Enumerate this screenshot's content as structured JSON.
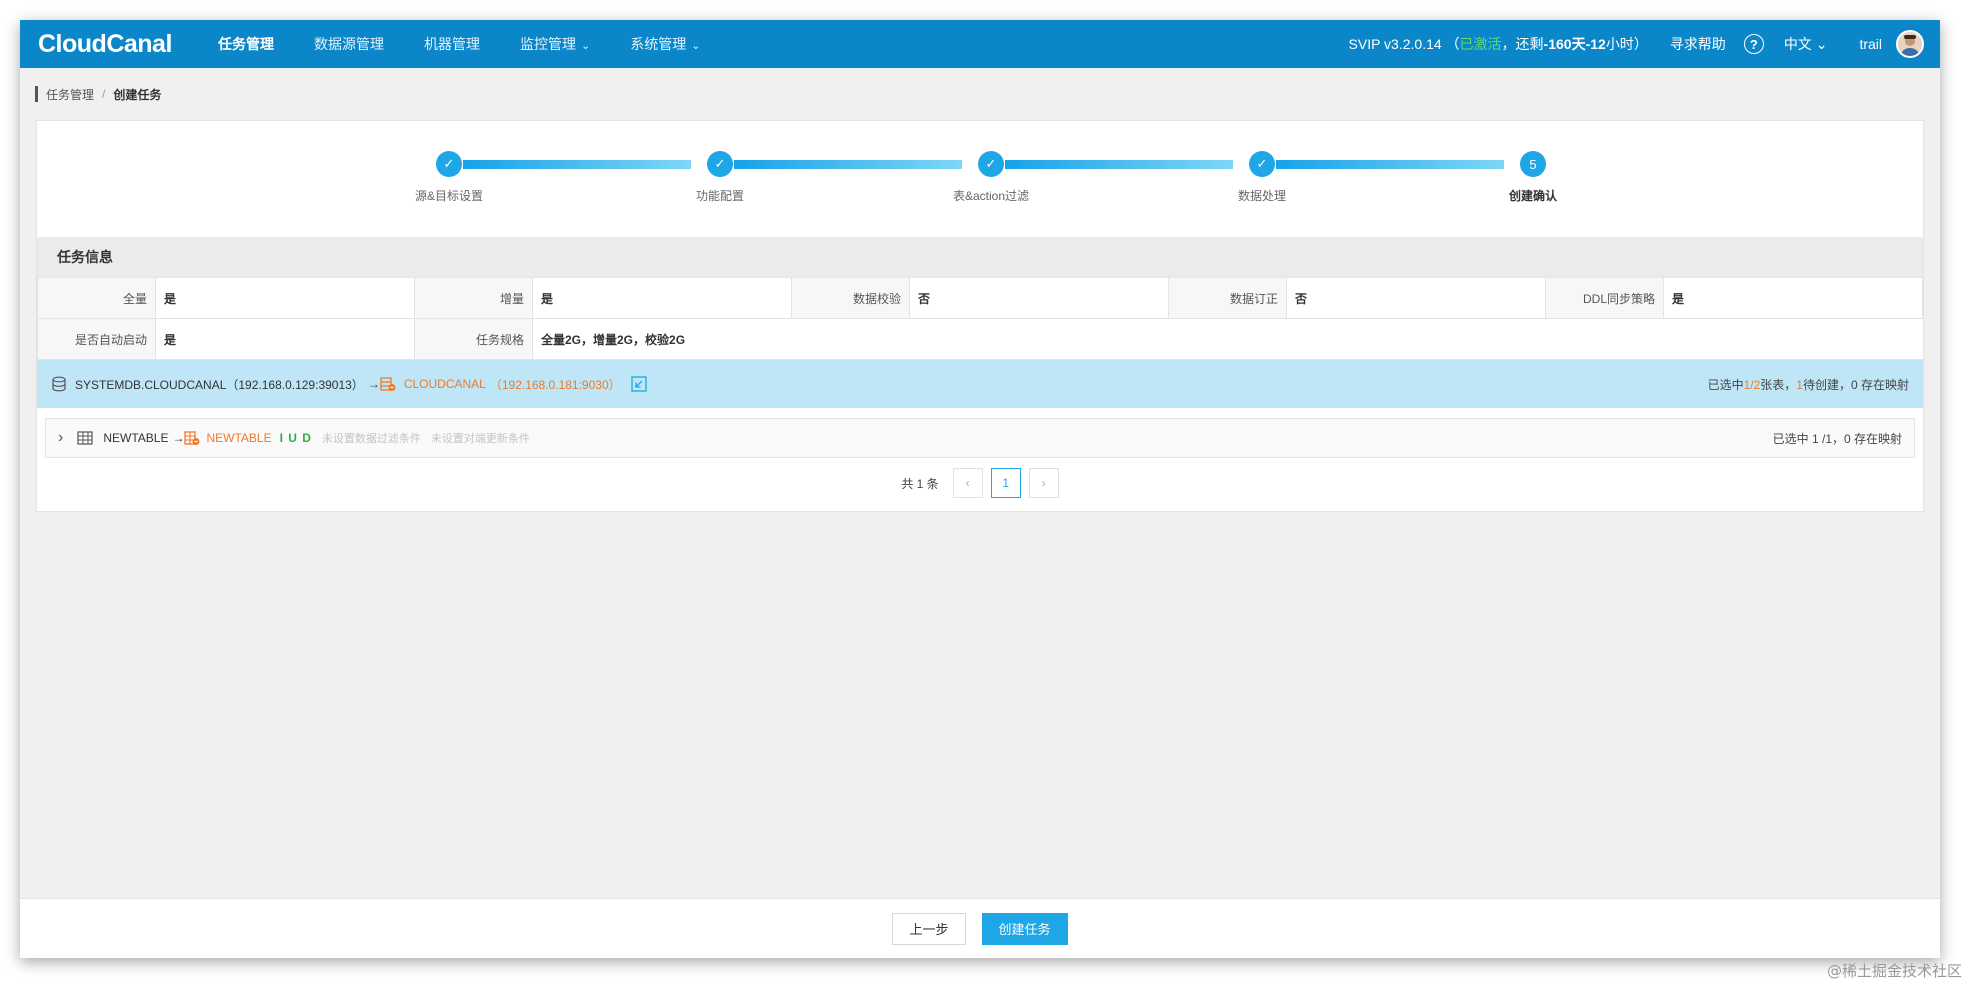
{
  "app": {
    "logo": "CloudCanal",
    "nav": [
      {
        "label": "任务管理",
        "active": true
      },
      {
        "label": "数据源管理"
      },
      {
        "label": "机器管理"
      },
      {
        "label": "监控管理",
        "dropdown": true
      },
      {
        "label": "系统管理",
        "dropdown": true
      }
    ],
    "version": "SVIP v3.2.0.14",
    "license_open": "（",
    "license_status": "已激活",
    "license_sep": "，还剩",
    "license_days": "-160天-12",
    "license_hours_unit": "小时",
    "license_close": "）",
    "help": "寻求帮助",
    "help_icon": "?",
    "language": "中文",
    "user": "trail",
    "chevron": "⌄"
  },
  "breadcrumb": {
    "parent": "任务管理",
    "sep": "/",
    "current": "创建任务"
  },
  "steps": [
    {
      "label": "源&目标设置",
      "state": "done"
    },
    {
      "label": "功能配置",
      "state": "done"
    },
    {
      "label": "表&action过滤",
      "state": "done"
    },
    {
      "label": "数据处理",
      "state": "done"
    },
    {
      "label": "创建确认",
      "state": "current",
      "number": "5"
    }
  ],
  "task_info": {
    "title": "任务信息",
    "row1": [
      {
        "key": "全量",
        "value": "是"
      },
      {
        "key": "增量",
        "value": "是"
      },
      {
        "key": "数据校验",
        "value": "否"
      },
      {
        "key": "数据订正",
        "value": "否"
      },
      {
        "key": "DDL同步策略",
        "value": "是"
      }
    ],
    "row2": [
      {
        "key": "是否自动启动",
        "value": "是"
      },
      {
        "key": "任务规格",
        "value": "全量2G，增量2G，校验2G"
      }
    ]
  },
  "mapping": {
    "source": "SYSTEMDB.CLOUDCANAL（192.168.0.129:39013）",
    "arrow": "→",
    "target_name": "CLOUDCANAL",
    "target_addr": "（192.168.0.181:9030）",
    "summary_prefix": "已选中",
    "summary_ratio": "1/2",
    "summary_mid": "张表，",
    "summary_pending": "1",
    "summary_suffix": "待创建，0 存在映射"
  },
  "table_row": {
    "expand": "›",
    "source": "NEWTABLE",
    "arrow": "→",
    "target": "NEWTABLE",
    "actions": "I U D",
    "hint1": "未设置数据过滤条件",
    "hint2": "未设置对端更新条件",
    "summary": "已选中 1 /1，0 存在映射"
  },
  "pagination": {
    "total": "共 1 条",
    "prev": "‹",
    "current": "1",
    "next": "›"
  },
  "footer": {
    "prev_label": "上一步",
    "create_label": "创建任务"
  },
  "watermark": "@稀土掘金技术社区",
  "colors": {
    "topbar": "#0b87c9",
    "accent": "#1ea6e6",
    "orange": "#f07a28",
    "green": "#2eae4b"
  }
}
